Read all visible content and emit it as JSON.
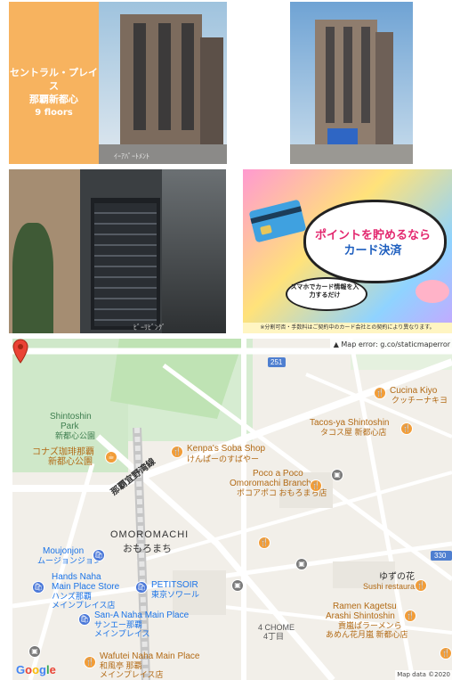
{
  "photos": {
    "building": {
      "name_line1": "セントラル・プレイス",
      "name_line2": "那覇新都心",
      "floors": "9 floors",
      "watermark": "ｲｰｱﾊﾟｰﾄﾒﾝﾄ"
    },
    "building_street": {
      "watermark": ""
    },
    "mailboxes": {
      "watermark": "ﾋﾞｰﾘﾋﾞﾝｸﾞ"
    },
    "promo": {
      "headline_part1": "ポイントを貯めるなら",
      "headline_part2": "カード決済",
      "small_bubble": "スマホでカード情報を入力するだけ",
      "footer": "※分割可否・手数料はご契約中のカード会社との契約により異なります。"
    }
  },
  "map": {
    "error_text": "Map error: g.co/staticmaperror",
    "map_data": "Map data ©2020",
    "google_logo": "Google",
    "route_251": "251",
    "route_330": "330",
    "labels": {
      "park_en": "Shintoshin",
      "park_en2": "Park",
      "park_ja": "新都心公園",
      "konazu_1": "コナズ珈琲那覇",
      "konazu_2": "新都心公園",
      "kenpas_en": "Kenpa's Soba Shop",
      "kenpas_ja": "けんぱーのすばやー",
      "cucina_en": "Cucina Kiyo",
      "cucina_ja": "クッチーナキヨ",
      "tacos_en": "Tacos-ya Shintoshin",
      "tacos_ja": "タコス屋 新都心店",
      "poco_en1": "Poco a Poco",
      "poco_en2": "Omoromachi Branch",
      "poco_ja": "ポコアポコ おもろまち店",
      "road_line": "那覇宜野湾線",
      "omoromachi_en": "OMOROMACHI",
      "omoromachi_ja": "おもろまち",
      "moujonjon_en": "Moujonjon",
      "moujonjon_ja": "ムージョンジョン",
      "hands_en1": "Hands Naha",
      "hands_en2": "Main Place Store",
      "hands_ja1": "ハンズ那覇",
      "hands_ja2": "メインプレイス店",
      "petitsoir_en": "PETITSOIR",
      "petitsoir_ja": "東京ソワール",
      "sana_en": "San-A Naha Main Place",
      "sana_ja1": "サンエー那覇",
      "sana_ja2": "メインプレイス",
      "yuzu_ja": "ゆずの花",
      "yuzu_en": "Sushi restaurant",
      "ramen_en1": "Ramen Kagetsu",
      "ramen_en2": "Arashi Shintoshin",
      "ramen_ja1": "貢嵐ぱラーメンら",
      "ramen_ja2": "あめん花月嵐 新都心店",
      "chome_en": "4 CHOME",
      "chome_ja": "4丁目",
      "wafutei_en": "Wafutei Naha Main Place",
      "wafutei_ja1": "和風亭 那覇",
      "wafutei_ja2": "メインプレイス店"
    }
  }
}
